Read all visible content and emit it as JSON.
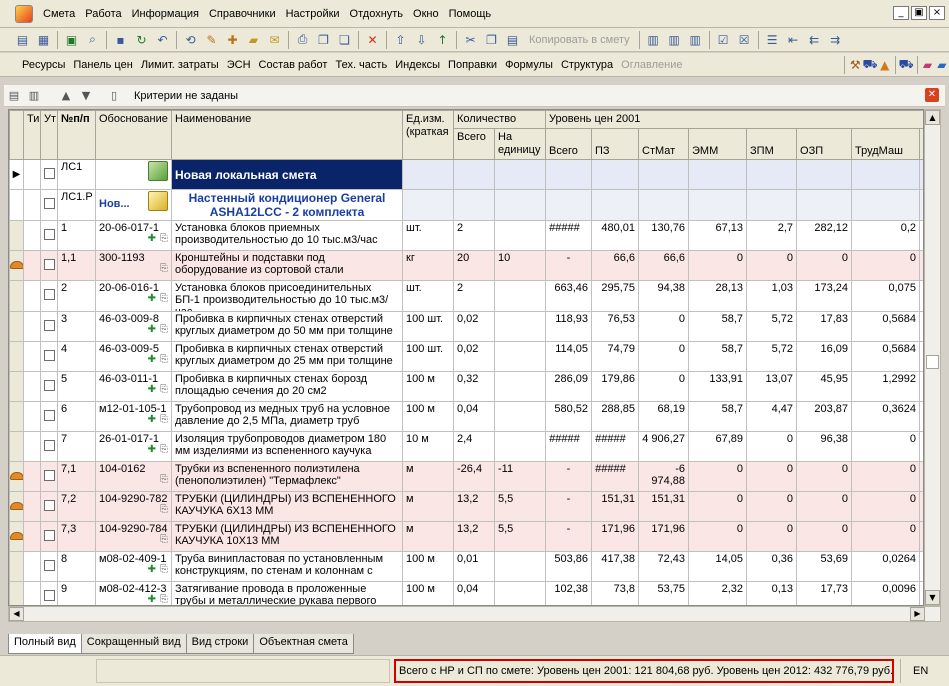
{
  "menu": [
    "Смета",
    "Работа",
    "Информация",
    "Справочники",
    "Настройки",
    "Отдохнуть",
    "Окно",
    "Помощь"
  ],
  "window_controls": [
    "_",
    "▣",
    "×"
  ],
  "toolbar1": {
    "copy_label": "Копировать в смету"
  },
  "toolbar2": {
    "items": [
      "Ресурсы",
      "Панель цен",
      "Лимит. затраты",
      "ЭСН",
      "Состав работ",
      "Тех. часть",
      "Индексы",
      "Поправки",
      "Формулы",
      "Структура"
    ],
    "disabled_item": "Оглавление"
  },
  "grid_toolbar": {
    "criteria": "Критерии не заданы"
  },
  "headers": {
    "ti": "Ти",
    "ut": "Ут",
    "npp": "№п/п",
    "basis": "Обоснование",
    "name": "Наименование",
    "unit": "Ед.изм. (краткая",
    "qty_group": "Количество",
    "qty_total": "Всего",
    "qty_per": "На единицу",
    "price_group": "Уровень цен 2001",
    "price_cols": [
      "Всего",
      "ПЗ",
      "СтМат",
      "ЭММ",
      "ЗПМ",
      "ОЗП",
      "ТрудМаш",
      "Н"
    ]
  },
  "rows": [
    {
      "kind": "ls",
      "npp": "ЛС1",
      "basis": "",
      "name": "Новая локальная смета"
    },
    {
      "kind": "sub",
      "npp": "ЛС1.Р",
      "basis": "Нов...",
      "name": "Настенный кондиционер General ASHA12LCC - 2 комплекта"
    },
    {
      "kind": "work",
      "npp": "1",
      "basis": "20-06-017-1",
      "name": "Установка блоков приемных производительностью до 10 тыс.м3/час",
      "unit": "шт.",
      "qty": "2",
      "per": "",
      "vals": [
        "#####",
        "480,01",
        "130,76",
        "67,13",
        "2,7",
        "282,12",
        "0,2"
      ]
    },
    {
      "kind": "mat",
      "npp": "1,1",
      "basis": "300-1193",
      "name": "Кронштейны и подставки под оборудование из сортовой стали",
      "unit": "кг",
      "qty": "20",
      "per": "10",
      "vals": [
        "-",
        "66,6",
        "66,6",
        "0",
        "0",
        "0",
        "0"
      ]
    },
    {
      "kind": "work",
      "npp": "2",
      "basis": "20-06-016-1",
      "name": "Установка блоков присоединительных БП-1 производительностью до 10 тыс.м3/час",
      "unit": "шт.",
      "qty": "2",
      "per": "",
      "vals": [
        "663,46",
        "295,75",
        "94,38",
        "28,13",
        "1,03",
        "173,24",
        "0,075"
      ]
    },
    {
      "kind": "work",
      "npp": "3",
      "basis": "46-03-009-8",
      "name": "Пробивка в кирпичных стенах отверстий круглых диаметром до 50 мм при толщине",
      "unit": "100 шт.",
      "qty": "0,02",
      "per": "",
      "vals": [
        "118,93",
        "76,53",
        "0",
        "58,7",
        "5,72",
        "17,83",
        "0,5684"
      ]
    },
    {
      "kind": "work",
      "npp": "4",
      "basis": "46-03-009-5",
      "name": "Пробивка в кирпичных стенах отверстий круглых диаметром до 25 мм при толщине",
      "unit": "100 шт.",
      "qty": "0,02",
      "per": "",
      "vals": [
        "114,05",
        "74,79",
        "0",
        "58,7",
        "5,72",
        "16,09",
        "0,5684"
      ]
    },
    {
      "kind": "work",
      "npp": "5",
      "basis": "46-03-011-1",
      "name": "Пробивка в кирпичных стенах борозд площадью сечения до 20 см2",
      "unit": "100 м",
      "qty": "0,32",
      "per": "",
      "vals": [
        "286,09",
        "179,86",
        "0",
        "133,91",
        "13,07",
        "45,95",
        "1,2992"
      ]
    },
    {
      "kind": "work",
      "npp": "6",
      "basis": "м12-01-105-1",
      "name": "Трубопровод из медных труб на условное давление до 2,5 МПа, диаметр труб",
      "unit": "100 м",
      "qty": "0,04",
      "per": "",
      "vals": [
        "580,52",
        "288,85",
        "68,19",
        "58,7",
        "4,47",
        "203,87",
        "0,3624"
      ]
    },
    {
      "kind": "work",
      "npp": "7",
      "basis": "26-01-017-1",
      "name": "Изоляция трубопроводов диаметром 180 мм изделиями из вспененного каучука",
      "unit": "10 м",
      "qty": "2,4",
      "per": "",
      "vals": [
        "#####",
        "#####",
        "4 906,27",
        "67,89",
        "0",
        "96,38",
        "0"
      ]
    },
    {
      "kind": "mat",
      "npp": "7,1",
      "basis": "104-0162",
      "name": "Трубки из вспененного полиэтилена (пенополиэтилен) \"Термафлекс\"",
      "unit": "м",
      "qty": "-26,4",
      "per": "-11",
      "vals": [
        "-",
        "#####",
        "-6 974,88",
        "0",
        "0",
        "0",
        "0"
      ]
    },
    {
      "kind": "mat",
      "npp": "7,2",
      "basis": "104-9290-782",
      "name": "ТРУБКИ (ЦИЛИНДРЫ) ИЗ ВСПЕНЕННОГО КАУЧУКА 6Х13 ММ",
      "unit": "м",
      "qty": "13,2",
      "per": "5,5",
      "vals": [
        "-",
        "151,31",
        "151,31",
        "0",
        "0",
        "0",
        "0"
      ]
    },
    {
      "kind": "mat",
      "npp": "7,3",
      "basis": "104-9290-784",
      "name": "ТРУБКИ (ЦИЛИНДРЫ) ИЗ ВСПЕНЕННОГО КАУЧУКА 10Х13 ММ",
      "unit": "м",
      "qty": "13,2",
      "per": "5,5",
      "vals": [
        "-",
        "171,96",
        "171,96",
        "0",
        "0",
        "0",
        "0"
      ]
    },
    {
      "kind": "work",
      "npp": "8",
      "basis": "м08-02-409-1",
      "name": "Труба винипластовая по установленным конструкциям, по стенам и колоннам с",
      "unit": "100 м",
      "qty": "0,01",
      "per": "",
      "vals": [
        "503,86",
        "417,38",
        "72,43",
        "14,05",
        "0,36",
        "53,69",
        "0,0264"
      ]
    },
    {
      "kind": "work",
      "npp": "9",
      "basis": "м08-02-412-3",
      "name": "Затягивание провода в проложенные трубы и металлические рукава первого",
      "unit": "100 м",
      "qty": "0,04",
      "per": "",
      "vals": [
        "102,38",
        "73,8",
        "53,75",
        "2,32",
        "0,13",
        "17,73",
        "0,0096"
      ]
    }
  ],
  "tabs": [
    "Полный вид",
    "Сокращенный вид",
    "Вид строки",
    "Объектная смета"
  ],
  "status": {
    "total": "Всего с НР и СП по смете: Уровень цен 2001: 121 804,68 руб. Уровень цен 2012: 432 776,79 руб.",
    "lang": "EN"
  }
}
